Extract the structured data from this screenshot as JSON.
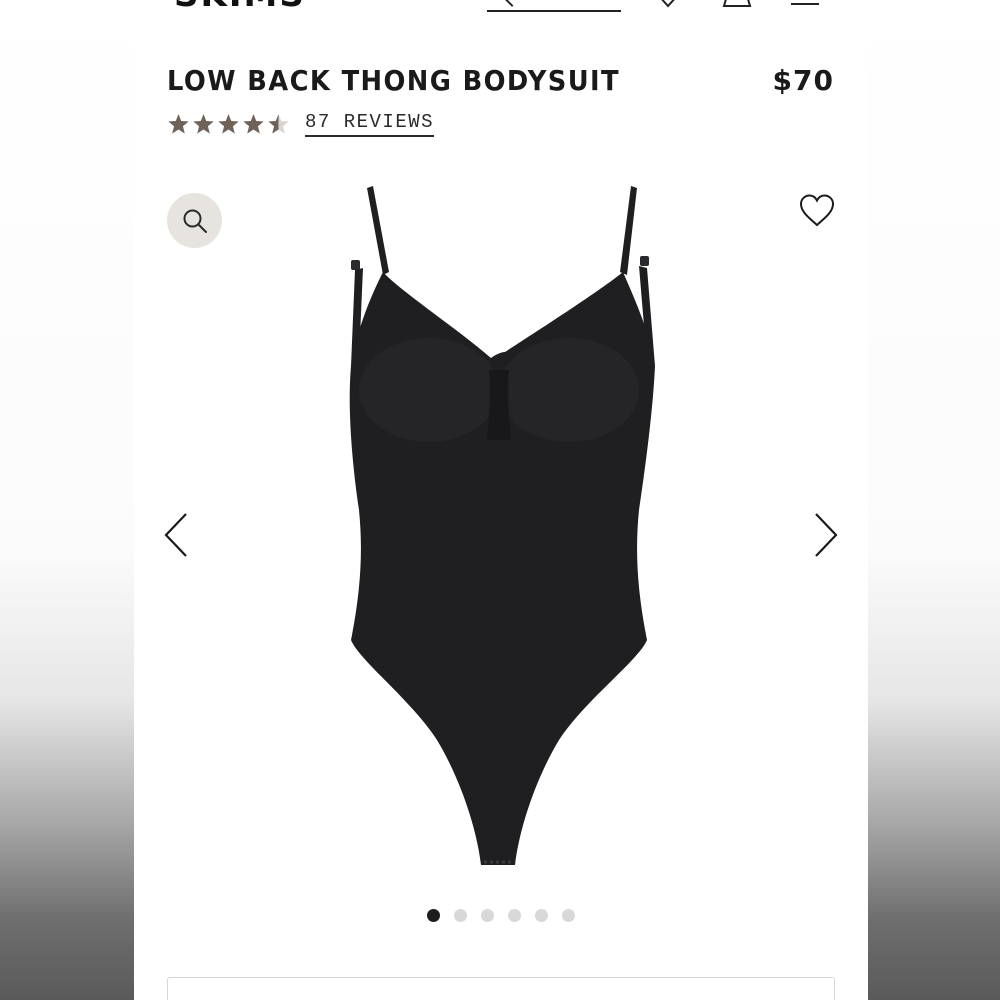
{
  "header": {
    "logo": "SKIMS"
  },
  "product": {
    "title": "LOW BACK THONG BODYSUIT",
    "price": "$70",
    "rating": 4.5,
    "rating_max": 5,
    "reviews_label": "87 REVIEWS"
  },
  "gallery": {
    "image_count": 6,
    "active_index": 0,
    "garment_color": "#1f1f22"
  },
  "colors": {
    "star": "#6f6259",
    "star_empty": "#d9d4cf",
    "zoom_bg": "#e7e4df",
    "dot_active": "#1d1d1d",
    "dot_inactive": "#d8d8d8"
  },
  "icons": [
    "search-icon",
    "heart-icon",
    "user-icon",
    "menu-icon",
    "zoom-icon",
    "wishlist-heart-icon",
    "chevron-left-icon",
    "chevron-right-icon",
    "star-icon"
  ]
}
